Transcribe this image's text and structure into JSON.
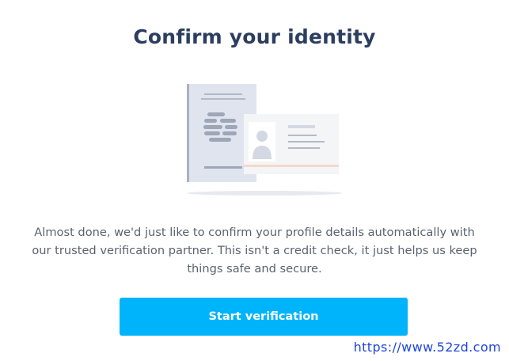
{
  "page": {
    "title": "Confirm your identity",
    "description": "Almost done, we'd just like to confirm your profile details automatically with our trusted verification partner. This isn't a credit check, it just helps us keep things safe and secure."
  },
  "actions": {
    "start_label": "Start verification"
  },
  "watermark": {
    "text": "https://www.52zd.com"
  },
  "colors": {
    "title": "#2c3e60",
    "button": "#00b4fb",
    "body_text": "#5b6270",
    "watermark": "#1f46e0"
  },
  "icons": {
    "illustration": "passport-and-id-card-illustration"
  }
}
